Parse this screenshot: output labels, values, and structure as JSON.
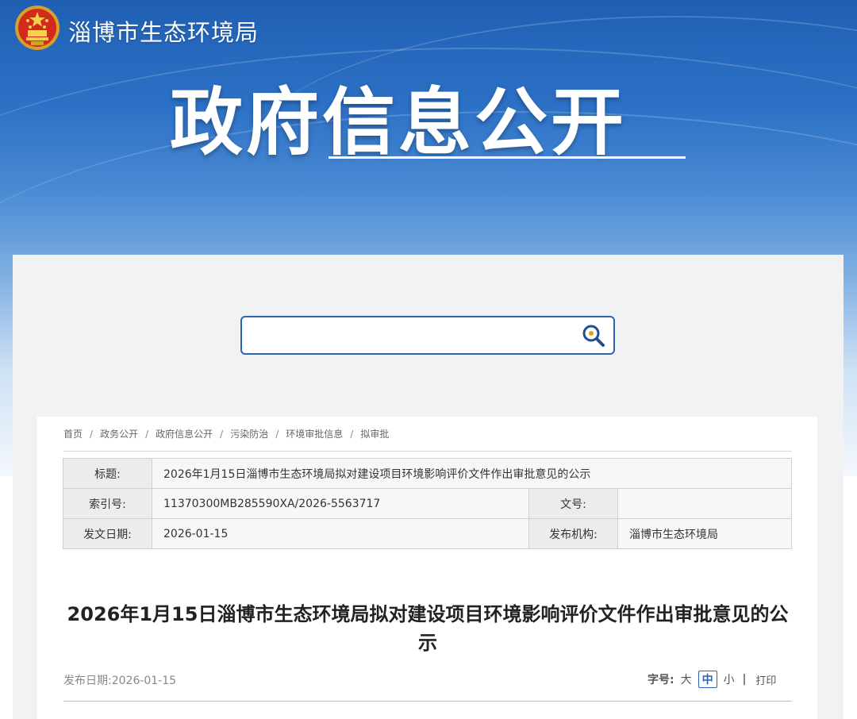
{
  "header": {
    "org_name": "淄博市生态环境局",
    "hero_title": "政府信息公开"
  },
  "search": {
    "placeholder": "",
    "value": ""
  },
  "breadcrumb": [
    "首页",
    "政务公开",
    "政府信息公开",
    "污染防治",
    "环境审批信息",
    "拟审批"
  ],
  "meta": {
    "title_label": "标题:",
    "title_value": "2026年1月15日淄博市生态环境局拟对建设项目环境影响评价文件作出审批意见的公示",
    "index_label": "索引号:",
    "index_value": "11370300MB285590XA/2026-5563717",
    "doc_no_label": "文号:",
    "doc_no_value": "",
    "issue_date_label": "发文日期:",
    "issue_date_value": "2026-01-15",
    "publisher_label": "发布机构:",
    "publisher_value": "淄博市生态环境局"
  },
  "article": {
    "title": "2026年1月15日淄博市生态环境局拟对建设项目环境影响评价文件作出审批意见的公示",
    "publish_date_label": "发布日期:",
    "publish_date": "2026-01-15"
  },
  "font_size_ctrl": {
    "label": "字号:",
    "large": "大",
    "medium": "中",
    "small": "小",
    "bar": "|",
    "print": "打印"
  },
  "colors": {
    "accent": "#2a64b2",
    "banner_top": "#1f5fb3"
  }
}
